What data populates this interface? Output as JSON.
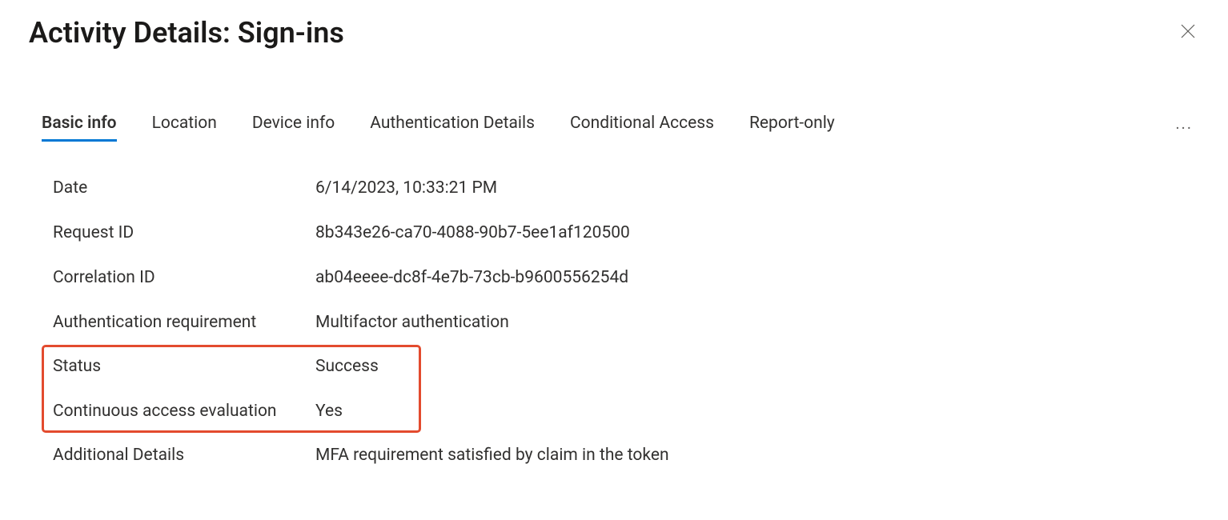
{
  "header": {
    "title": "Activity Details: Sign-ins"
  },
  "tabs": {
    "items": [
      {
        "label": "Basic info",
        "active": true
      },
      {
        "label": "Location",
        "active": false
      },
      {
        "label": "Device info",
        "active": false
      },
      {
        "label": "Authentication Details",
        "active": false
      },
      {
        "label": "Conditional Access",
        "active": false
      },
      {
        "label": "Report-only",
        "active": false
      }
    ]
  },
  "details": {
    "date": {
      "label": "Date",
      "value": "6/14/2023, 10:33:21 PM"
    },
    "requestId": {
      "label": "Request ID",
      "value": "8b343e26-ca70-4088-90b7-5ee1af120500"
    },
    "correlationId": {
      "label": "Correlation ID",
      "value": "ab04eeee-dc8f-4e7b-73cb-b9600556254d"
    },
    "authRequirement": {
      "label": "Authentication requirement",
      "value": "Multifactor authentication"
    },
    "status": {
      "label": "Status",
      "value": "Success"
    },
    "cae": {
      "label": "Continuous access evaluation",
      "value": "Yes"
    },
    "additional": {
      "label": "Additional Details",
      "value": "MFA requirement satisfied by claim in the token"
    }
  }
}
